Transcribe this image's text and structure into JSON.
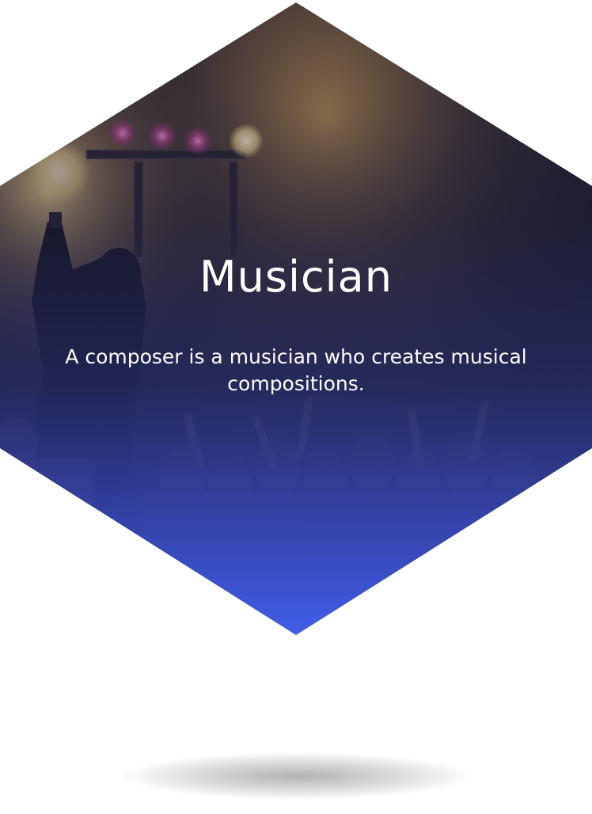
{
  "card": {
    "title": "Musician",
    "description": "A composer is a musician who creates musical compositions.",
    "image_subject": "concert-performer-with-crowd",
    "colors": {
      "gradient_top": "#1c1e3e",
      "gradient_bottom": "#4260ee",
      "stage_light": "#f6d78a",
      "text": "#ffffff"
    }
  }
}
